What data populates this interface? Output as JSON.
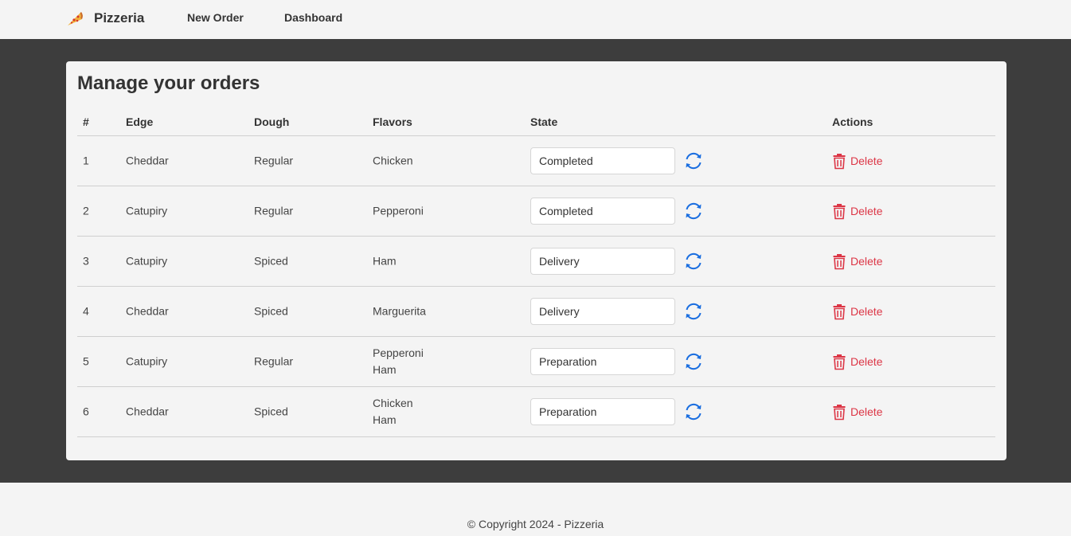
{
  "navbar": {
    "brand": "Pizzeria",
    "brand_icon": "pizza-slice-icon",
    "links": [
      "New Order",
      "Dashboard"
    ]
  },
  "card": {
    "title": "Manage your orders"
  },
  "table": {
    "headers": {
      "num": "#",
      "edge": "Edge",
      "dough": "Dough",
      "flavors": "Flavors",
      "state": "State",
      "actions": "Actions"
    },
    "rows": [
      {
        "num": "1",
        "edge": "Cheddar",
        "dough": "Regular",
        "flavors": [
          "Chicken"
        ],
        "state": "Completed",
        "action": "Delete"
      },
      {
        "num": "2",
        "edge": "Catupiry",
        "dough": "Regular",
        "flavors": [
          "Pepperoni"
        ],
        "state": "Completed",
        "action": "Delete"
      },
      {
        "num": "3",
        "edge": "Catupiry",
        "dough": "Spiced",
        "flavors": [
          "Ham"
        ],
        "state": "Delivery",
        "action": "Delete"
      },
      {
        "num": "4",
        "edge": "Cheddar",
        "dough": "Spiced",
        "flavors": [
          "Marguerita"
        ],
        "state": "Delivery",
        "action": "Delete"
      },
      {
        "num": "5",
        "edge": "Catupiry",
        "dough": "Regular",
        "flavors": [
          "Pepperoni",
          "Ham"
        ],
        "state": "Preparation",
        "action": "Delete"
      },
      {
        "num": "6",
        "edge": "Cheddar",
        "dough": "Spiced",
        "flavors": [
          "Chicken",
          "Ham"
        ],
        "state": "Preparation",
        "action": "Delete"
      }
    ]
  },
  "footer": {
    "text": "© Copyright 2024 - Pizzeria"
  },
  "colors": {
    "band": "#3d3d3d",
    "card": "#f4f4f4",
    "delete": "#dc3545",
    "refresh": "#1a6ee0"
  },
  "icons": {
    "refresh": "refresh-icon",
    "delete": "trash-icon"
  }
}
